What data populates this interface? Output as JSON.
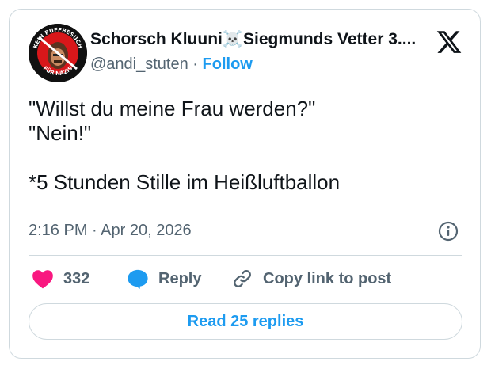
{
  "author": {
    "display_name": "Schorsch Kluuni☠️Siegmunds Vetter 3....",
    "handle": "@andi_stuten",
    "separator": "·",
    "follow_label": "Follow",
    "avatar_badge_top": "KEIN PUFFBESUCH",
    "avatar_badge_bottom": "FÜR NAZIS"
  },
  "tweet": {
    "lines": [
      "\"Willst du meine Frau werden?\"",
      "\"Nein!\"",
      "",
      "*5 Stunden Stille im Heißluftballon"
    ],
    "timestamp": "2:16 PM · Apr 20, 2026"
  },
  "actions": {
    "like_count": "332",
    "reply_label": "Reply",
    "copy_label": "Copy link to post",
    "read_replies_label": "Read 25 replies"
  },
  "icons": {
    "brand": "x-logo-icon",
    "like": "heart-icon",
    "reply": "speech-bubble-icon",
    "copy": "link-icon",
    "info": "info-icon"
  },
  "colors": {
    "heart": "#f91880",
    "reply_bubble": "#1d9bf0",
    "link_blue": "#1d9bf0",
    "muted": "#536471",
    "border": "#cfd9de"
  }
}
